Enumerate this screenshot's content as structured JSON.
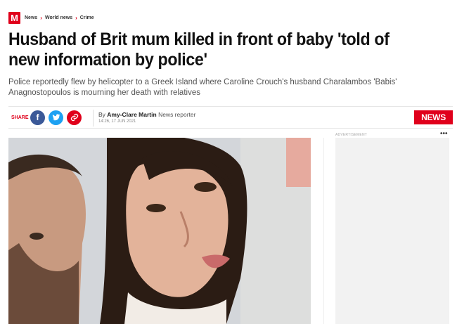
{
  "brand": {
    "logo_letter": "M",
    "accent": "#e0001b"
  },
  "breadcrumb": [
    "News",
    "World news",
    "Crime"
  ],
  "article": {
    "headline": "Husband of Brit mum killed in front of baby 'told of new information by police'",
    "standfirst": "Police reportedly flew by helicopter to a Greek Island where Caroline Crouch's husband Charalambos 'Babis' Anagnostopoulos is mourning her death with relatives",
    "share_label": "SHARE",
    "byline_prefix": "By",
    "author": "Amy-Clare Martin",
    "author_role": "News reporter",
    "timestamp": "14:26, 17 JUN 2021",
    "section_tag": "NEWS"
  },
  "share_icons": {
    "facebook": "facebook-icon",
    "twitter": "twitter-icon",
    "link": "link-icon"
  },
  "sidebar": {
    "ad_label": "ADVERTISEMENT",
    "menu": "•••"
  }
}
